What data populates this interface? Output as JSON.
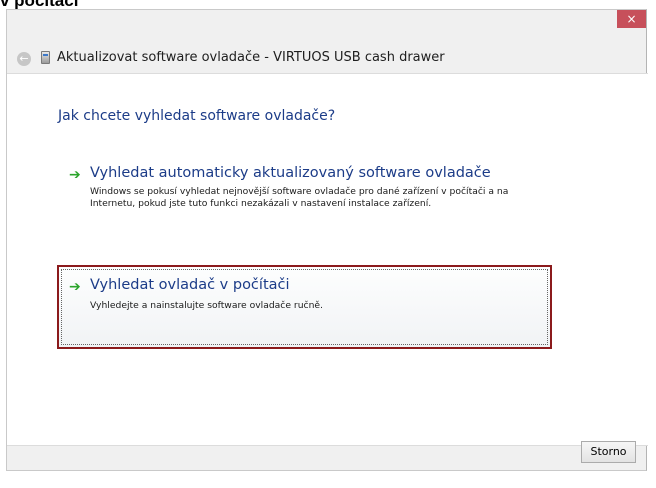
{
  "document": {
    "heading": "v počítači"
  },
  "window": {
    "title": "Aktualizovat software ovladače - VIRTUOS USB cash drawer",
    "close_glyph": "×",
    "back_glyph": "←",
    "question": "Jak chcete vyhledat software ovladače?",
    "options": [
      {
        "title": "Vyhledat automaticky aktualizovaný software ovladače",
        "description": "Windows se pokusí vyhledat nejnovější software ovladače pro dané zařízení v počítači a na Internetu, pokud jste tuto funkci nezakázali v nastavení instalace zařízení."
      },
      {
        "title": "Vyhledat ovladač v počítači",
        "description": "Vyhledejte a nainstalujte software ovladače ručně."
      }
    ],
    "cancel_label": "Storno"
  },
  "icons": {
    "back": "back-arrow-icon",
    "device": "usb-device-icon",
    "option_arrow": "green-arrow-icon",
    "close": "close-icon"
  },
  "colors": {
    "link_blue": "#1c3c88",
    "arrow_green": "#2ca52c",
    "highlight_border": "#8b1a1c",
    "close_red": "#c7505b"
  }
}
